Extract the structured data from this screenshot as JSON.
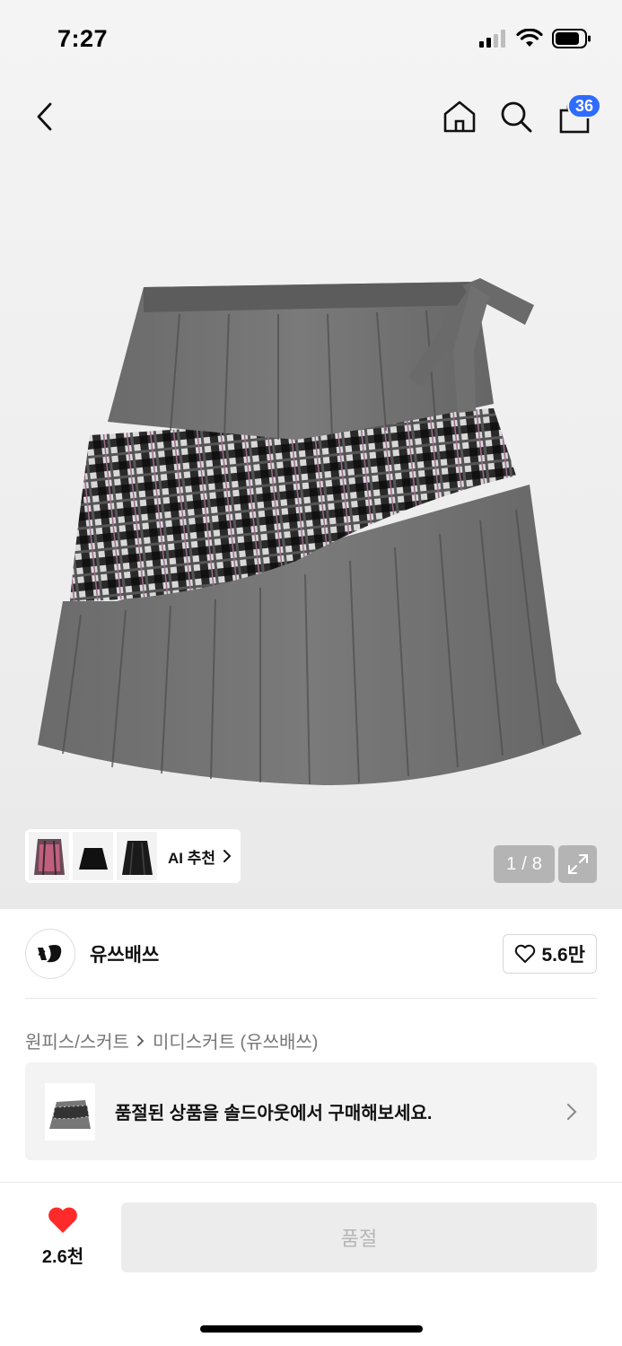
{
  "status_bar": {
    "time": "7:27"
  },
  "nav": {
    "back_icon": "chevron-left-icon",
    "home_icon": "home-icon",
    "search_icon": "search-icon",
    "cart_icon": "shopping-bag-icon",
    "cart_count": "36"
  },
  "gallery": {
    "ai_label": "AI 추천",
    "page_current": "1",
    "page_total": "8",
    "counter_sep": "/"
  },
  "brand": {
    "name": "유쓰배쓰",
    "likes": "5.6만"
  },
  "breadcrumb": {
    "category": "원피스/스커트",
    "subcategory": "미디스커트 (유쓰배쓰)"
  },
  "soldout_banner": {
    "text": "품절된 상품을 솔드아웃에서 구매해보세요."
  },
  "bottom": {
    "like_count": "2.6천",
    "buy_label": "품절"
  },
  "colors": {
    "badge": "#2f6bff",
    "heart": "#ff2a2a",
    "disabled_button_bg": "#ececec",
    "disabled_button_text": "#b6b6b6"
  }
}
